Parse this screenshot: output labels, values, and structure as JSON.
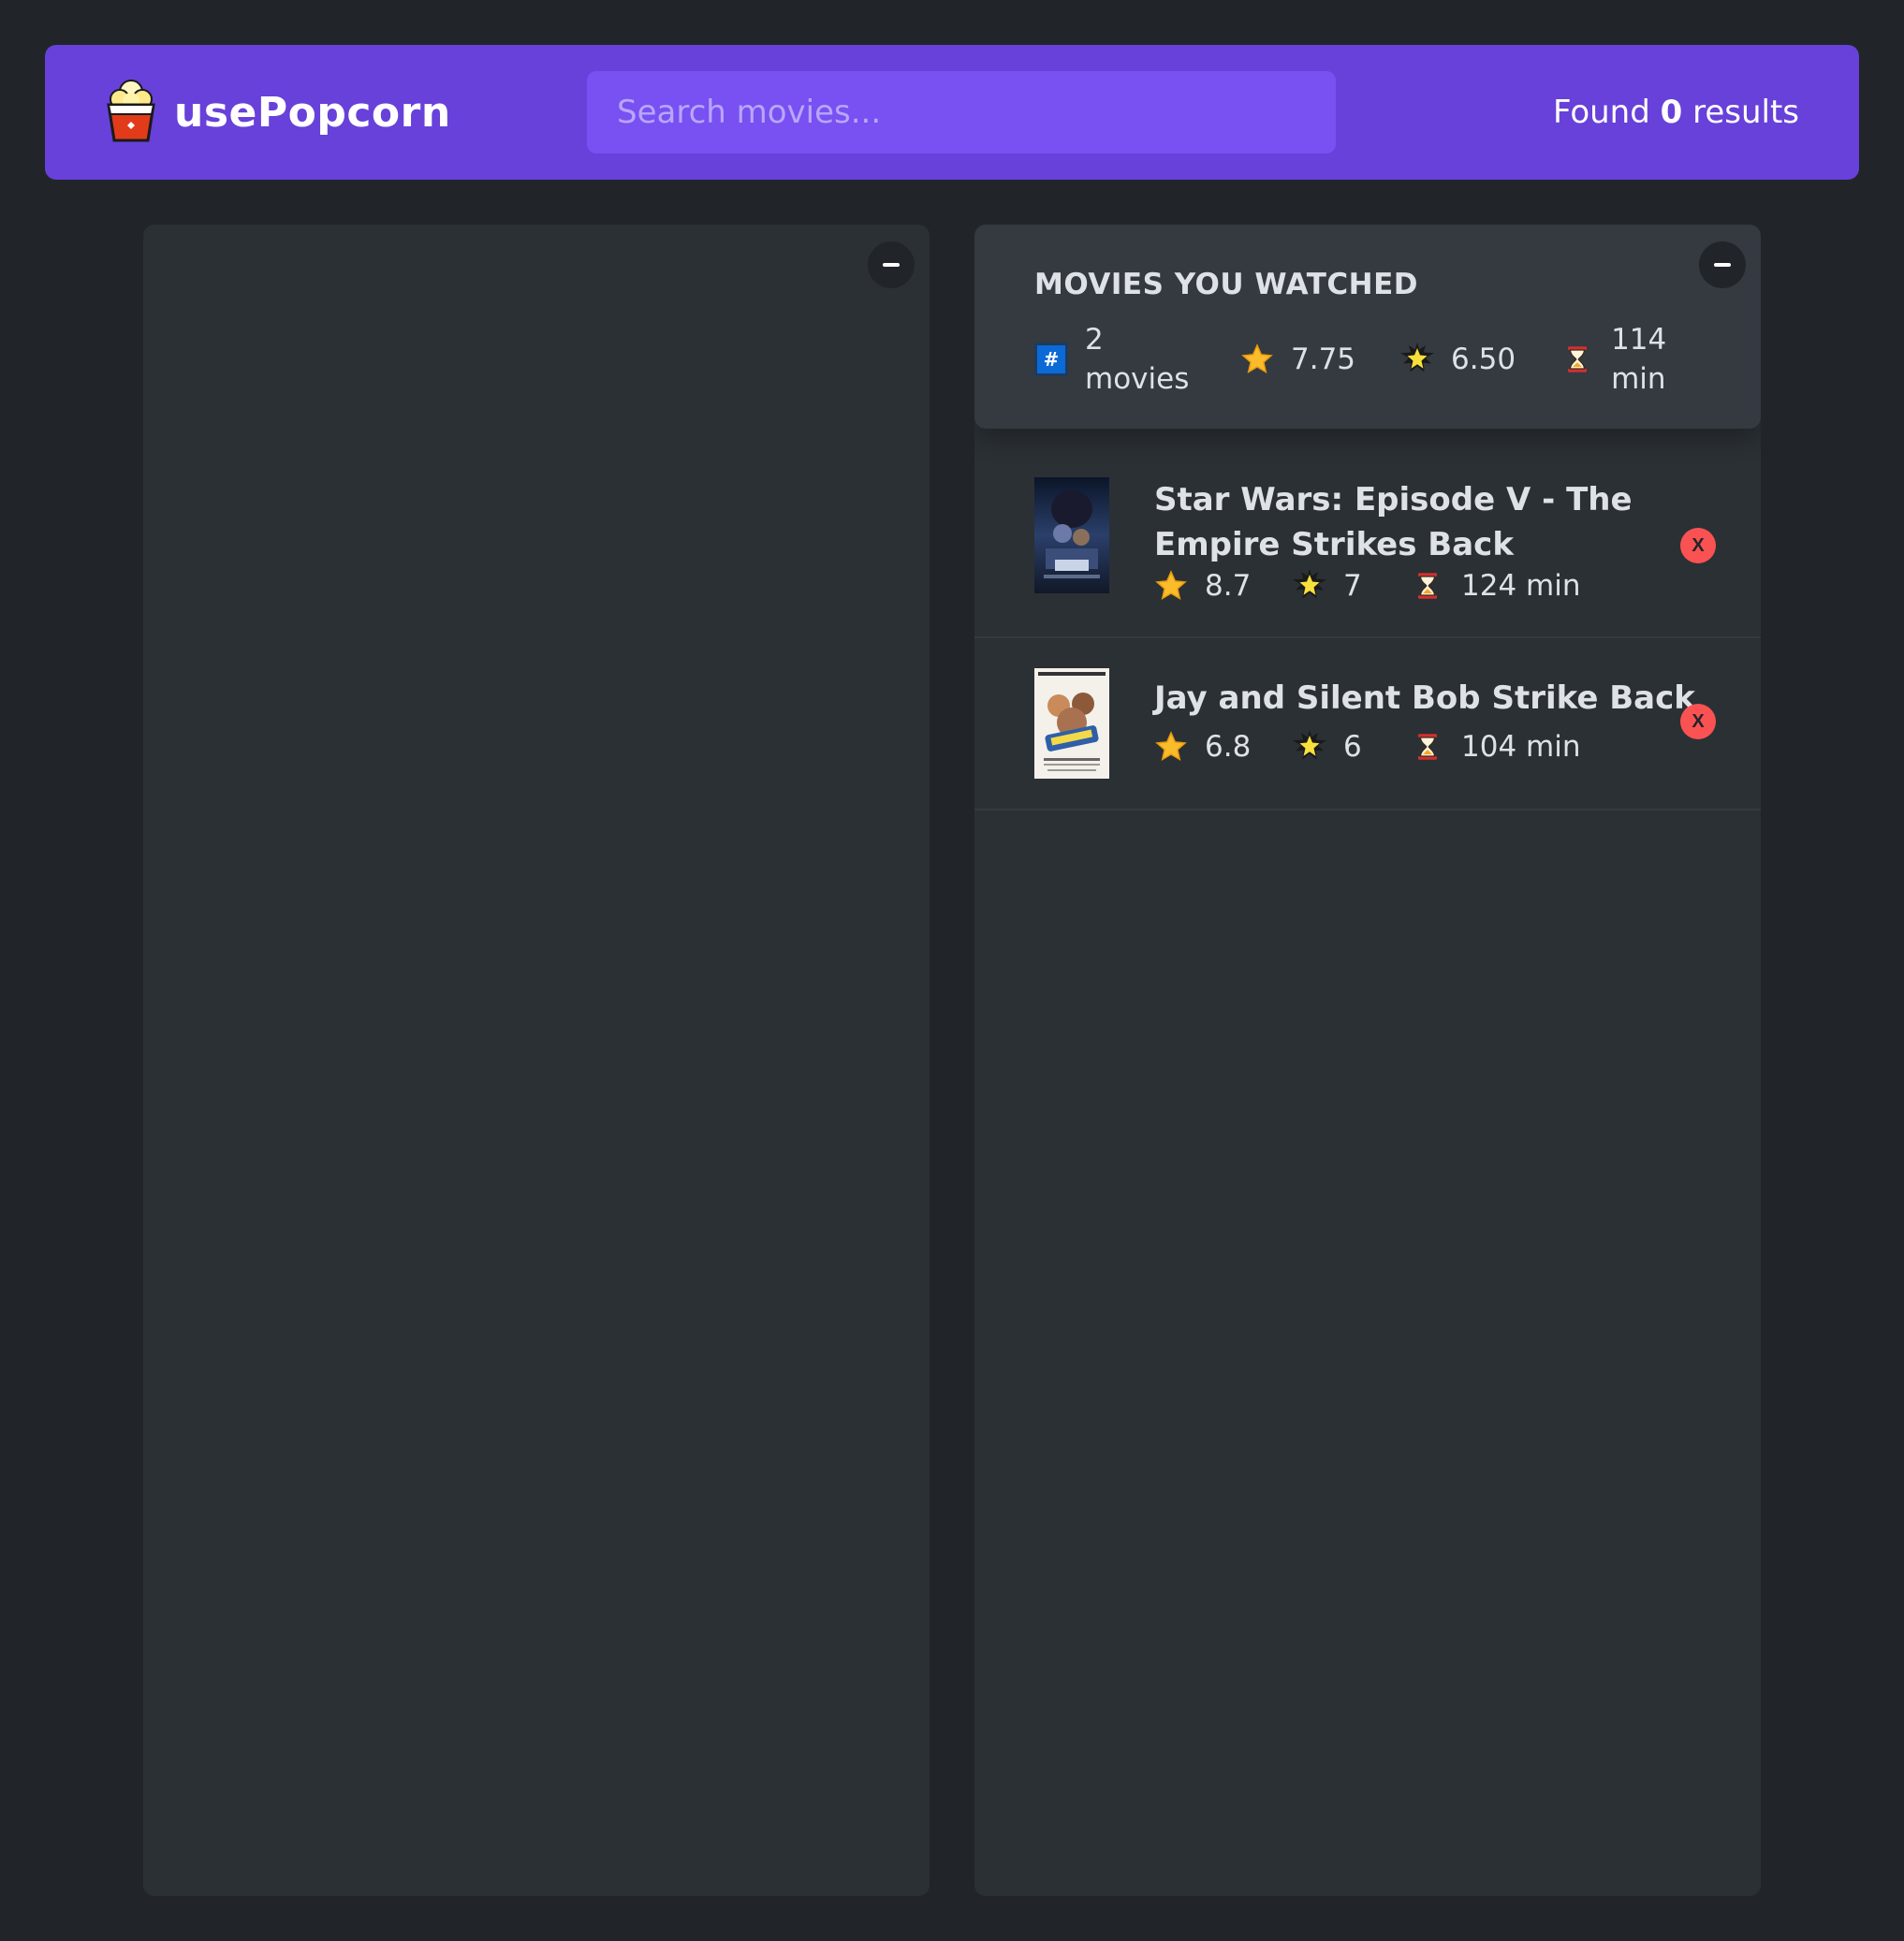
{
  "navbar": {
    "logo_icon": "popcorn-icon",
    "title": "usePopcorn",
    "search_placeholder": "Search movies...",
    "results_prefix": "Found ",
    "results_count": "0",
    "results_suffix": " results"
  },
  "left_box": {
    "toggle_label": "–"
  },
  "right_box": {
    "toggle_label": "–",
    "summary": {
      "heading": "Movies you watched",
      "count_icon": "hash-icon",
      "count_num": "2",
      "count_unit": "movies",
      "avg_imdb_icon": "star-icon",
      "avg_imdb": "7.75",
      "avg_user_icon": "glowing-star-icon",
      "avg_user": "6.50",
      "avg_runtime_icon": "hourglass-icon",
      "avg_runtime_num": "114",
      "avg_runtime_unit": "min"
    },
    "movies": [
      {
        "title": "Star Wars: Episode V - The Empire Strikes Back",
        "imdb_rating": "8.7",
        "user_rating": "7",
        "runtime": "124 min",
        "delete_label": "X"
      },
      {
        "title": "Jay and Silent Bob Strike Back",
        "imdb_rating": "6.8",
        "user_rating": "6",
        "runtime": "104 min",
        "delete_label": "X"
      }
    ]
  },
  "colors": {
    "background": "#212529",
    "navbar": "#6741d9",
    "search": "#7950f2",
    "box": "#2b3035",
    "summary": "#343a40",
    "delete": "#fa5252"
  }
}
